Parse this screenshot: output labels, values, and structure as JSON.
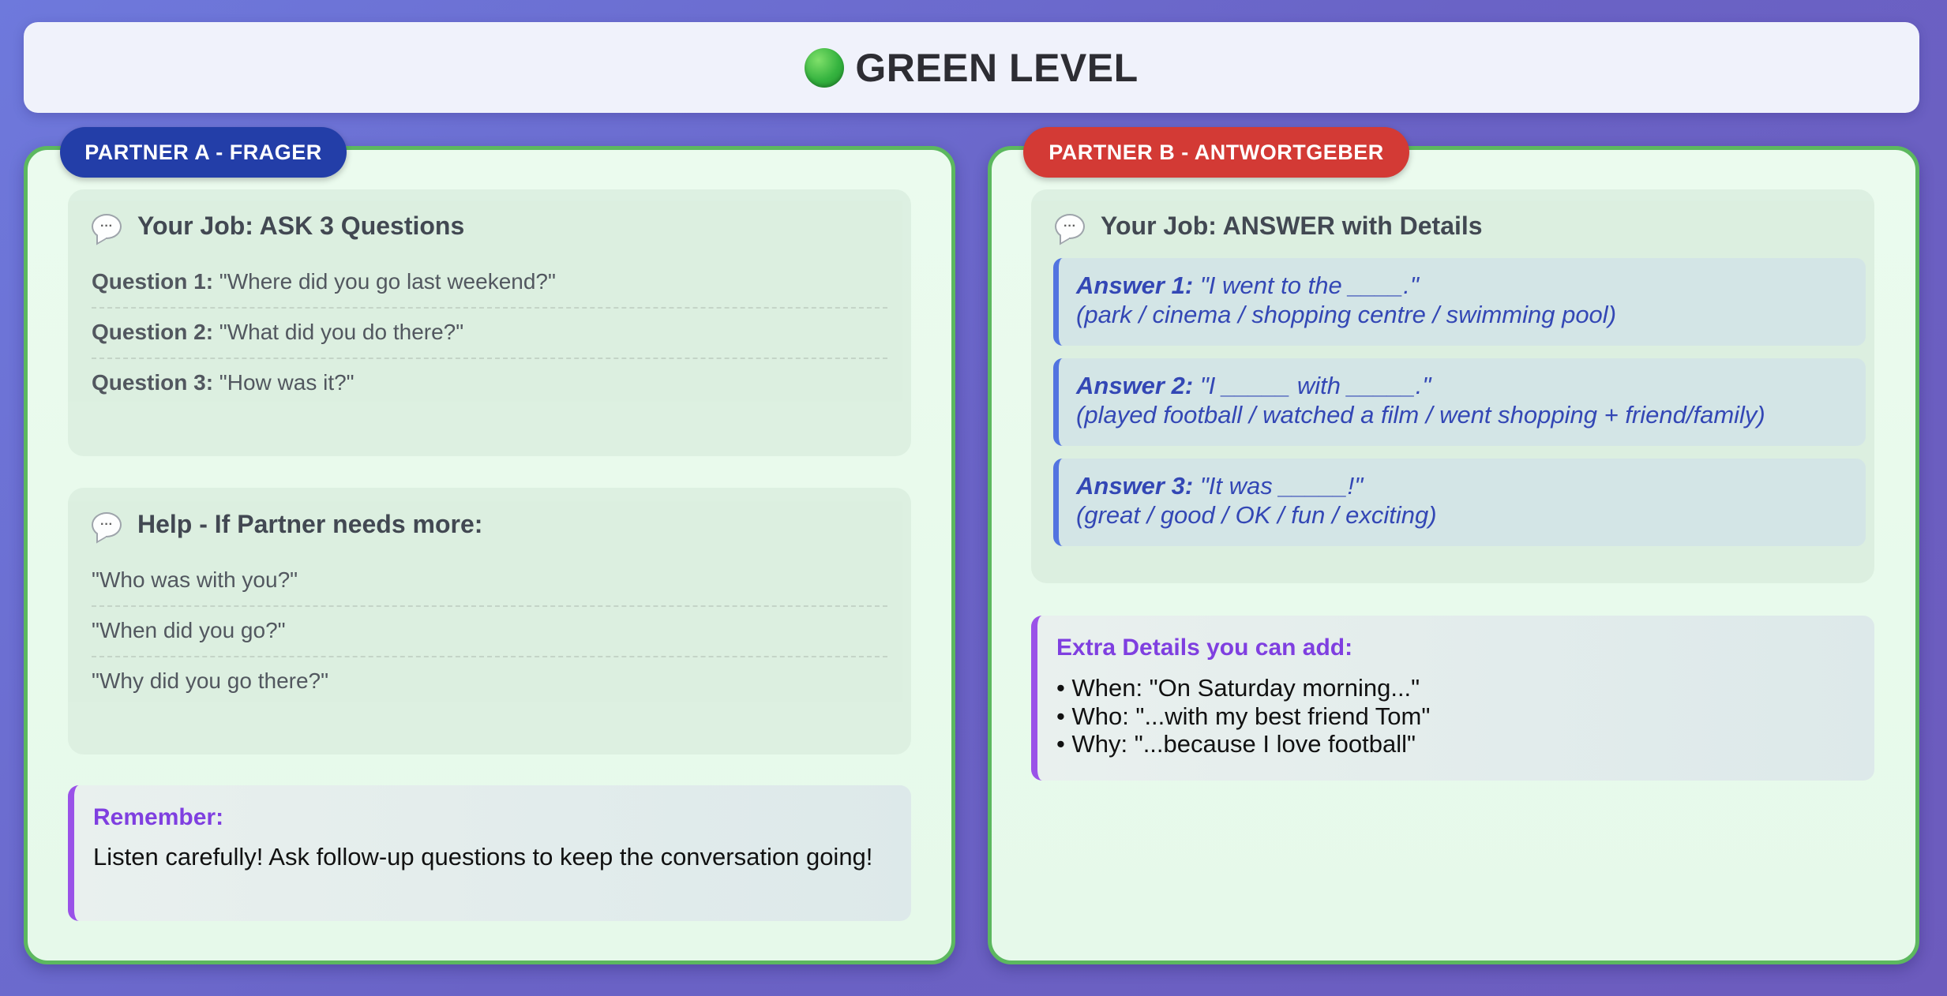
{
  "header": {
    "title": "GREEN LEVEL",
    "icon": "green-circle-icon",
    "icon_color": "#35b33f"
  },
  "partner_a": {
    "tag": "PARTNER A - FRAGER",
    "tag_color": "#233ea8",
    "job_card": {
      "heading": "Your Job: ASK 3 Questions",
      "questions": [
        {
          "label": "Question 1:",
          "text": "\"Where did you go last weekend?\""
        },
        {
          "label": "Question 2:",
          "text": "\"What did you do there?\""
        },
        {
          "label": "Question 3:",
          "text": "\"How was it?\""
        }
      ]
    },
    "help_card": {
      "heading": "Help - If Partner needs more:",
      "items": [
        "\"Who was with you?\"",
        "\"When did you go?\"",
        "\"Why did you go there?\""
      ]
    },
    "remember": {
      "title": "Remember:",
      "text": "Listen carefully! Ask follow-up questions to keep the conversation going!"
    }
  },
  "partner_b": {
    "tag": "PARTNER B - ANTWORTGEBER",
    "tag_color": "#d33a35",
    "job_card": {
      "heading": "Your Job: ANSWER with Details",
      "answers": [
        {
          "label": "Answer 1:",
          "text": "\"I went to the ____.\"",
          "options": "(park / cinema / shopping centre / swimming pool)"
        },
        {
          "label": "Answer 2:",
          "text": "\"I _____ with _____.\"",
          "options": "(played football / watched a film / went shopping + friend/family)"
        },
        {
          "label": "Answer 3:",
          "text": "\"It was _____!\"",
          "options": "(great / good / OK / fun / exciting)"
        }
      ]
    },
    "extra": {
      "title": "Extra Details you can add:",
      "items": [
        "When: \"On Saturday morning...\"",
        "Who: \"...with my best friend Tom\"",
        "Why: \"...because I love football\""
      ]
    }
  },
  "colors": {
    "panel_border": "#5cb85f",
    "accent_purple": "#9a52e8",
    "answer_blue": "#2a3eb3"
  }
}
